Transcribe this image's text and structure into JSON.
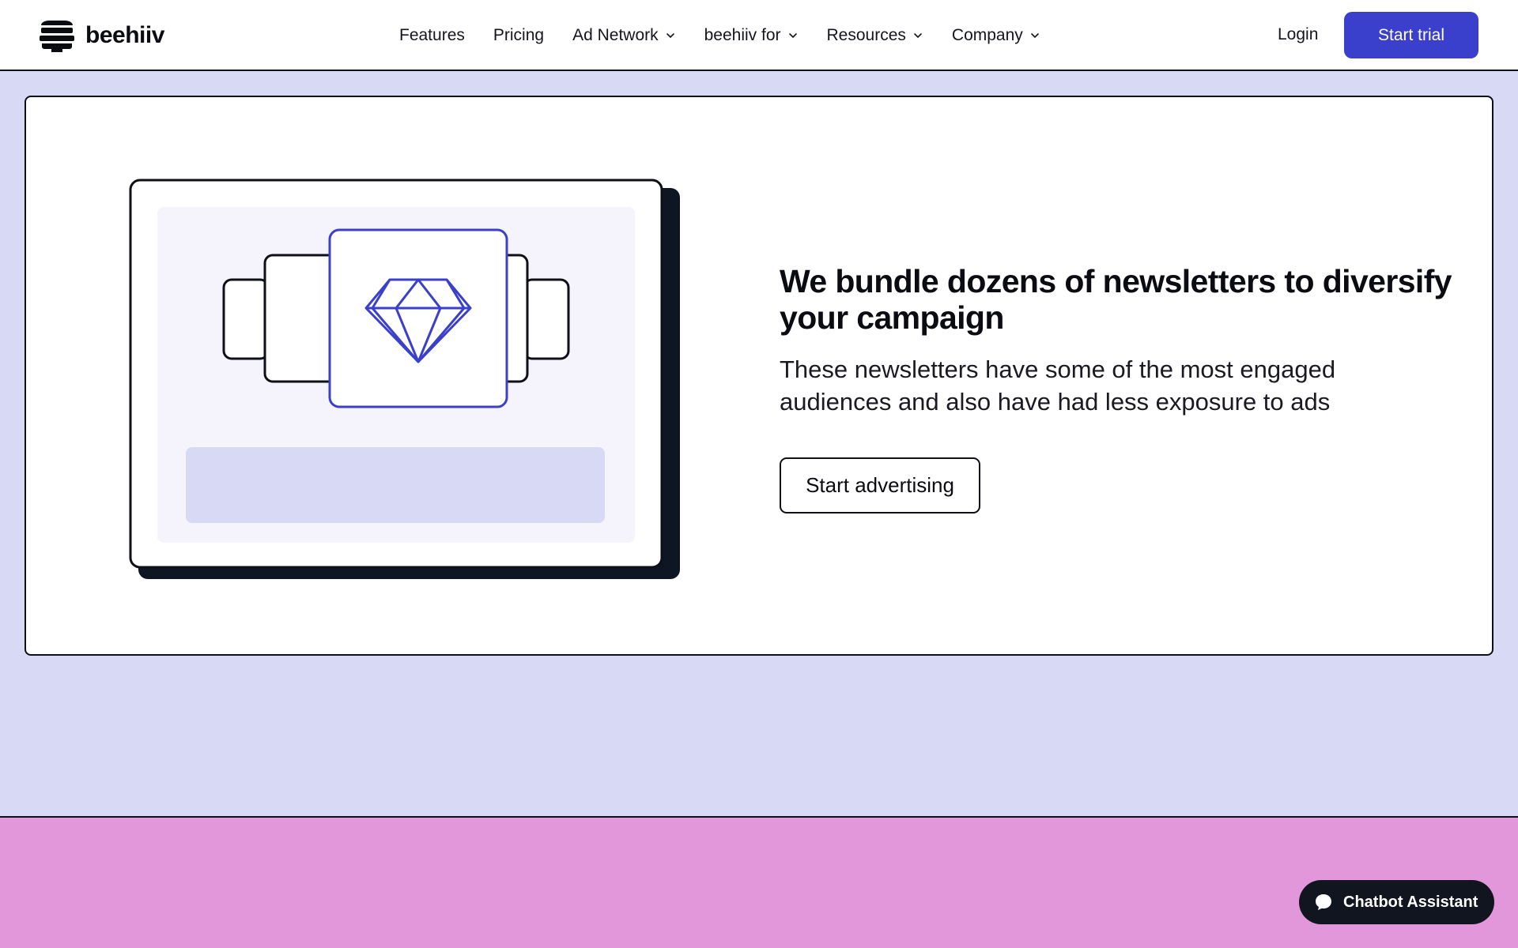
{
  "nav": {
    "brand": "beehiiv",
    "links": [
      {
        "label": "Features",
        "dropdown": false
      },
      {
        "label": "Pricing",
        "dropdown": false
      },
      {
        "label": "Ad Network",
        "dropdown": true
      },
      {
        "label": "beehiiv for",
        "dropdown": true
      },
      {
        "label": "Resources",
        "dropdown": true
      },
      {
        "label": "Company",
        "dropdown": true
      }
    ],
    "login": "Login",
    "cta": "Start trial"
  },
  "feature": {
    "headline": "We bundle dozens of newsletters to diversify your campaign",
    "subtext": "These newsletters have some of the most engaged audiences and also have had less exposure to ads",
    "button": "Start advertising"
  },
  "chatbot": {
    "label": "Chatbot Assistant"
  },
  "colors": {
    "accent": "#3a3fcc",
    "page_bg": "#d8d9f4",
    "pink_section": "#e197d9",
    "dark": "#0f0f17"
  }
}
